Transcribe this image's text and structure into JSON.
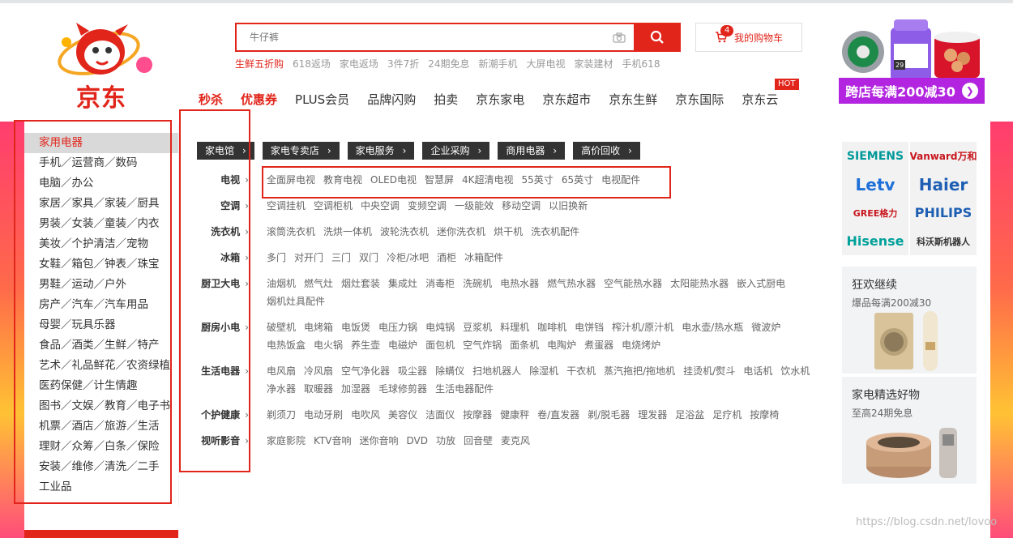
{
  "header": {
    "logo_text": "京东",
    "search": {
      "placeholder": "牛仔裤"
    },
    "hotwords": [
      "生鲜五折购",
      "618返场",
      "家电返场",
      "3件7折",
      "24期免息",
      "新潮手机",
      "大屏电视",
      "家装建材",
      "手机618"
    ],
    "cart": {
      "label": "我的购物车",
      "count": "4"
    },
    "nav": [
      {
        "label": "秒杀",
        "highlight": true
      },
      {
        "label": "优惠券",
        "highlight": true
      },
      {
        "label": "PLUS会员",
        "highlight": false
      },
      {
        "label": "品牌闪购",
        "highlight": false
      },
      {
        "label": "拍卖",
        "highlight": false
      },
      {
        "label": "京东家电",
        "highlight": false
      },
      {
        "label": "京东超市",
        "highlight": false
      },
      {
        "label": "京东生鲜",
        "highlight": false
      },
      {
        "label": "京东国际",
        "highlight": false
      },
      {
        "label": "京东云",
        "highlight": false
      }
    ],
    "hot_badge": "HOT",
    "promo": "跨店每满200减30",
    "promo_box_number": "29"
  },
  "categories": [
    "家用电器",
    "手机／运营商／数码",
    "电脑／办公",
    "家居／家具／家装／厨具",
    "男装／女装／童装／内衣",
    "美妆／个护清洁／宠物",
    "女鞋／箱包／钟表／珠宝",
    "男鞋／运动／户外",
    "房产／汽车／汽车用品",
    "母婴／玩具乐器",
    "食品／酒类／生鲜／特产",
    "艺术／礼品鲜花／农资绿植",
    "医药保健／计生情趣",
    "图书／文娱／教育／电子书",
    "机票／酒店／旅游／生活",
    "理财／众筹／白条／保险",
    "安装／维修／清洗／二手",
    "工业品"
  ],
  "channels": [
    "家电馆",
    "家电专卖店",
    "家电服务",
    "企业采购",
    "商用电器",
    "高价回收"
  ],
  "rows": [
    {
      "title": "电视",
      "items": [
        "全面屏电视",
        "教育电视",
        "OLED电视",
        "智慧屏",
        "4K超清电视",
        "55英寸",
        "65英寸",
        "电视配件"
      ]
    },
    {
      "title": "空调",
      "items": [
        "空调挂机",
        "空调柜机",
        "中央空调",
        "变频空调",
        "一级能效",
        "移动空调",
        "以旧换新"
      ]
    },
    {
      "title": "洗衣机",
      "items": [
        "滚筒洗衣机",
        "洗烘一体机",
        "波轮洗衣机",
        "迷你洗衣机",
        "烘干机",
        "洗衣机配件"
      ]
    },
    {
      "title": "冰箱",
      "items": [
        "多门",
        "对开门",
        "三门",
        "双门",
        "冷柜/冰吧",
        "酒柜",
        "冰箱配件"
      ]
    },
    {
      "title": "厨卫大电",
      "items": [
        "油烟机",
        "燃气灶",
        "烟灶套装",
        "集成灶",
        "消毒柜",
        "洗碗机",
        "电热水器",
        "燃气热水器",
        "空气能热水器",
        "太阳能热水器",
        "嵌入式厨电",
        "烟机灶具配件"
      ]
    },
    {
      "title": "厨房小电",
      "items": [
        "破壁机",
        "电烤箱",
        "电饭煲",
        "电压力锅",
        "电炖锅",
        "豆浆机",
        "料理机",
        "咖啡机",
        "电饼铛",
        "榨汁机/原汁机",
        "电水壶/热水瓶",
        "微波炉",
        "电热饭盒",
        "电火锅",
        "养生壶",
        "电磁炉",
        "面包机",
        "空气炸锅",
        "面条机",
        "电陶炉",
        "煮蛋器",
        "电烧烤炉"
      ]
    },
    {
      "title": "生活电器",
      "items": [
        "电风扇",
        "冷风扇",
        "空气净化器",
        "吸尘器",
        "除螨仪",
        "扫地机器人",
        "除湿机",
        "干衣机",
        "蒸汽拖把/拖地机",
        "挂烫机/熨斗",
        "电话机",
        "饮水机",
        "净水器",
        "取暖器",
        "加湿器",
        "毛球修剪器",
        "生活电器配件"
      ]
    },
    {
      "title": "个护健康",
      "items": [
        "剃须刀",
        "电动牙刷",
        "电吹风",
        "美容仪",
        "洁面仪",
        "按摩器",
        "健康秤",
        "卷/直发器",
        "剃/脱毛器",
        "理发器",
        "足浴盆",
        "足疗机",
        "按摩椅"
      ]
    },
    {
      "title": "视听影音",
      "items": [
        "家庭影院",
        "KTV音响",
        "迷你音响",
        "DVD",
        "功放",
        "回音壁",
        "麦克风"
      ]
    }
  ],
  "brands": [
    {
      "name": "SIEMENS",
      "color": "#009999"
    },
    {
      "name": "Vanward万和",
      "color": "#c8161d"
    },
    {
      "name": "Letv",
      "color": "#1e6fd9"
    },
    {
      "name": "Haier",
      "color": "#1e5fb3"
    },
    {
      "name": "GREE格力",
      "color": "#c8161d"
    },
    {
      "name": "PHILIPS",
      "color": "#1e5fb3"
    },
    {
      "name": "Hisense",
      "color": "#00a19a"
    },
    {
      "name": "科沃斯机器人",
      "color": "#333333"
    }
  ],
  "ads": [
    {
      "title": "狂欢继续",
      "subtitle": "爆品每满200减30"
    },
    {
      "title": "家电精选好物",
      "subtitle": "至高24期免息"
    }
  ],
  "watermark": "https://blog.csdn.net/lovoo"
}
